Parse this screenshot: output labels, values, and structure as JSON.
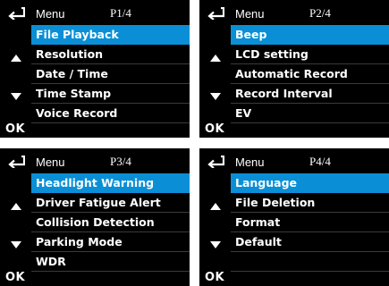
{
  "screens": [
    {
      "menu": "Menu",
      "page": "P1/4",
      "ok": "OK",
      "items": [
        "File Playback",
        "Resolution",
        "Date / Time",
        "Time Stamp",
        "Voice Record"
      ]
    },
    {
      "menu": "Menu",
      "page": "P2/4",
      "ok": "OK",
      "items": [
        "Beep",
        "LCD setting",
        "Automatic Record",
        "Record Interval",
        "EV"
      ]
    },
    {
      "menu": "Menu",
      "page": "P3/4",
      "ok": "OK",
      "items": [
        "Headlight Warning",
        "Driver Fatigue Alert",
        "Collision Detection",
        "Parking Mode",
        "WDR"
      ]
    },
    {
      "menu": "Menu",
      "page": "P4/4",
      "ok": "OK",
      "items": [
        "Language",
        "File Deletion",
        "Format",
        "Default",
        ""
      ]
    }
  ],
  "colors": {
    "background": "#000000",
    "selected": "#0a8fd6",
    "text": "#ffffff"
  }
}
